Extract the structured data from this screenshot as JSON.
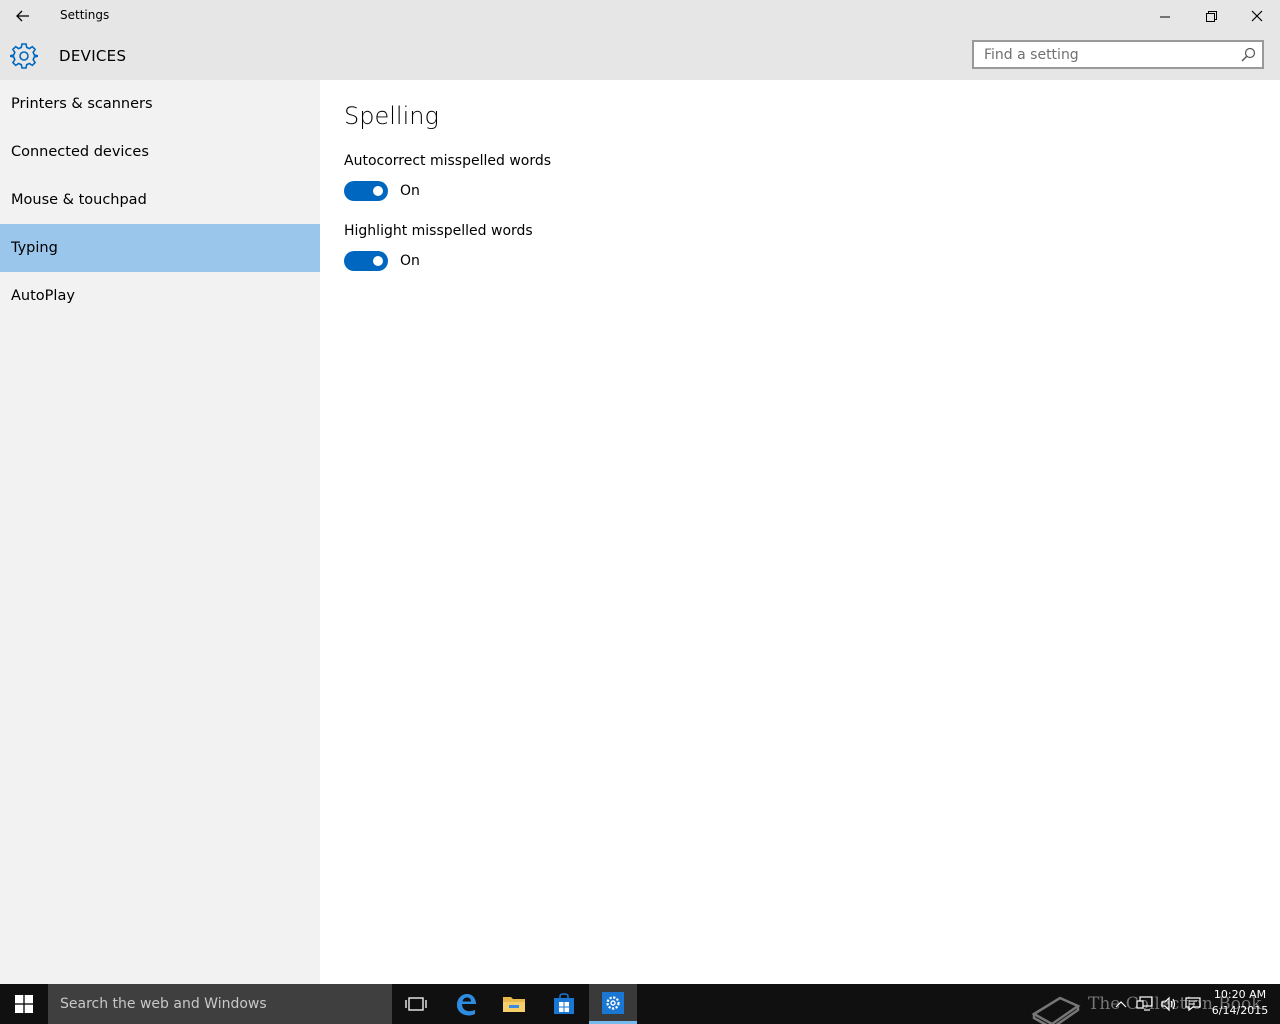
{
  "window": {
    "title": "Settings",
    "controls": [
      "minimize",
      "restore",
      "close"
    ]
  },
  "header": {
    "section": "DEVICES",
    "search_placeholder": "Find a setting"
  },
  "sidebar": {
    "items": [
      {
        "label": "Printers & scanners",
        "active": false
      },
      {
        "label": "Connected devices",
        "active": false
      },
      {
        "label": "Mouse & touchpad",
        "active": false
      },
      {
        "label": "Typing",
        "active": true
      },
      {
        "label": "AutoPlay",
        "active": false
      }
    ]
  },
  "content": {
    "heading": "Spelling",
    "options": [
      {
        "label": "Autocorrect misspelled words",
        "state": "On",
        "enabled": true
      },
      {
        "label": "Highlight misspelled words",
        "state": "On",
        "enabled": true
      }
    ]
  },
  "taskbar": {
    "search_placeholder": "Search the web and Windows",
    "apps": [
      "task-view",
      "edge",
      "file-explorer",
      "store",
      "settings"
    ],
    "active_app": "settings",
    "clock": {
      "time": "10:20 AM",
      "date": "6/14/2015"
    }
  },
  "watermark": {
    "text": "The Collection Book"
  },
  "colors": {
    "accent": "#0067c0",
    "selected_nav": "#99c6ea",
    "chrome": "#e6e6e6",
    "sidebar": "#f2f2f2",
    "taskbar": "#101010"
  }
}
